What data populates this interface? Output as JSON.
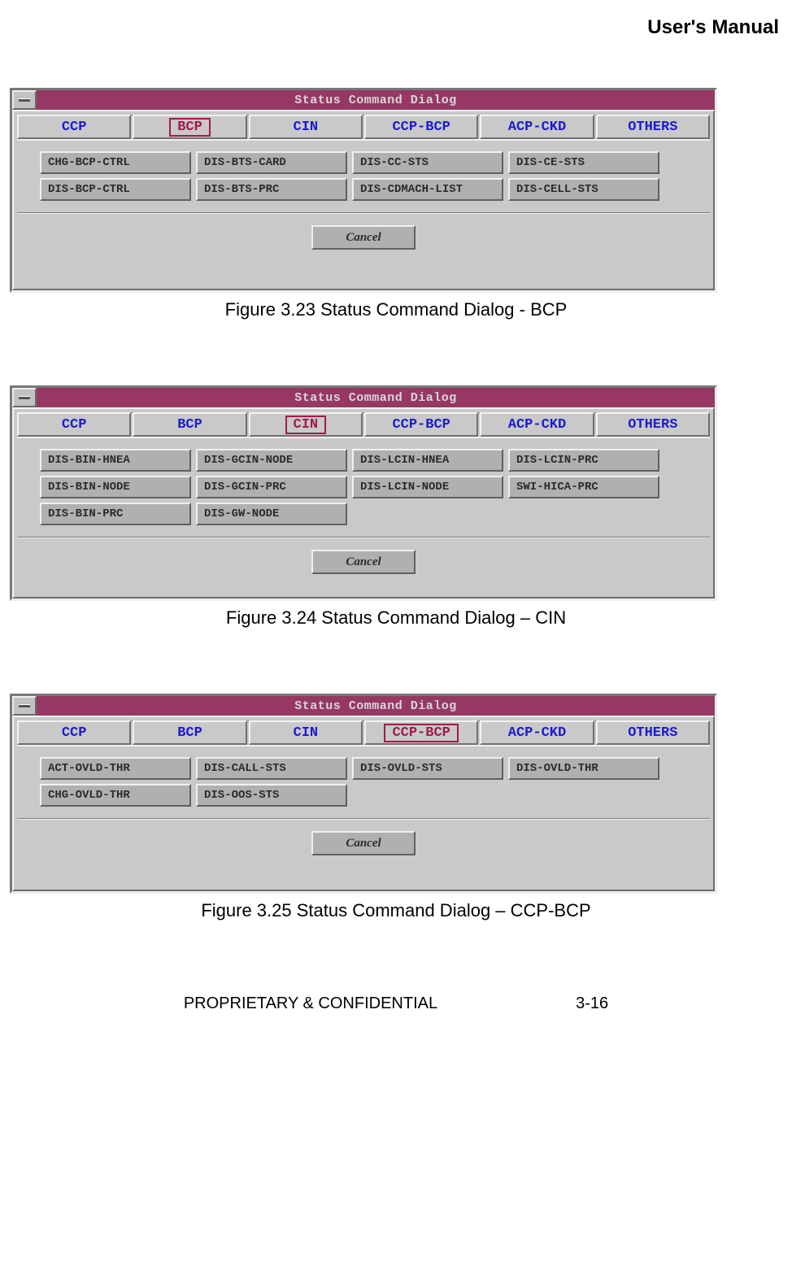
{
  "header": "User's Manual",
  "figures": [
    {
      "title": "Status Command Dialog",
      "tabs": [
        "CCP",
        "BCP",
        "CIN",
        "CCP-BCP",
        "ACP-CKD",
        "OTHERS"
      ],
      "selected_index": 1,
      "commands": [
        "CHG-BCP-CTRL",
        "DIS-BTS-CARD",
        "DIS-CC-STS",
        "DIS-CE-STS",
        "DIS-BCP-CTRL",
        "DIS-BTS-PRC",
        "DIS-CDMACH-LIST",
        "DIS-CELL-STS"
      ],
      "cancel": "Cancel",
      "caption": "Figure 3.23 Status Command Dialog - BCP"
    },
    {
      "title": "Status Command Dialog",
      "tabs": [
        "CCP",
        "BCP",
        "CIN",
        "CCP-BCP",
        "ACP-CKD",
        "OTHERS"
      ],
      "selected_index": 2,
      "commands": [
        "DIS-BIN-HNEA",
        "DIS-GCIN-NODE",
        "DIS-LCIN-HNEA",
        "DIS-LCIN-PRC",
        "DIS-BIN-NODE",
        "DIS-GCIN-PRC",
        "DIS-LCIN-NODE",
        "SWI-HICA-PRC",
        "DIS-BIN-PRC",
        "DIS-GW-NODE"
      ],
      "cancel": "Cancel",
      "caption": "Figure 3.24 Status Command Dialog – CIN"
    },
    {
      "title": "Status Command Dialog",
      "tabs": [
        "CCP",
        "BCP",
        "CIN",
        "CCP-BCP",
        "ACP-CKD",
        "OTHERS"
      ],
      "selected_index": 3,
      "commands": [
        "ACT-OVLD-THR",
        "DIS-CALL-STS",
        "DIS-OVLD-STS",
        "DIS-OVLD-THR",
        "CHG-OVLD-THR",
        "DIS-OOS-STS"
      ],
      "cancel": "Cancel",
      "caption": "Figure 3.25 Status Command Dialog – CCP-BCP"
    }
  ],
  "footer": {
    "left": "PROPRIETARY & CONFIDENTIAL",
    "right": "3-16"
  }
}
